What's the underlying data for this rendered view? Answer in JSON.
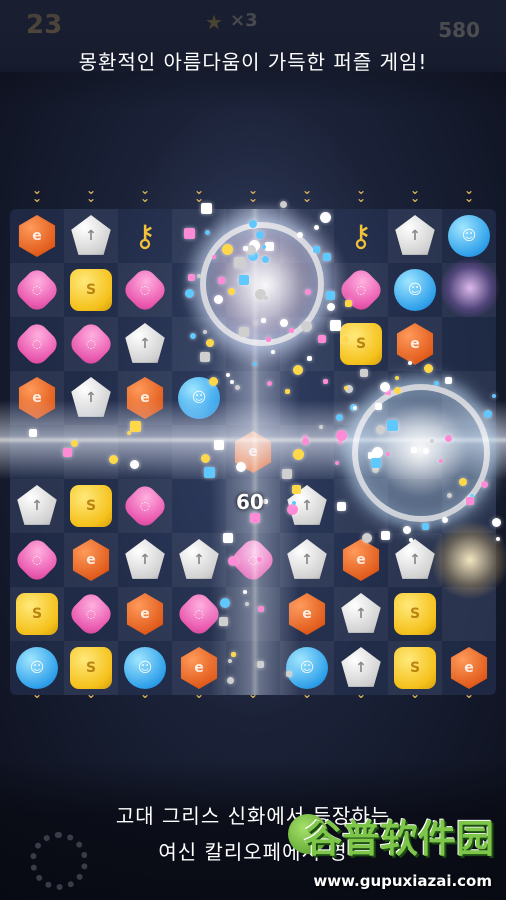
{
  "hud": {
    "score_left": "23",
    "combo": "×3",
    "score_right": "580"
  },
  "top_banner": {
    "text": "몽환적인 아름다움이 가득한 퍼즐 게임!"
  },
  "bottom_banner": {
    "line1": "고대 그리스 신화에서 등장하는",
    "line2": "여신 칼리오페에서 영"
  },
  "effect": {
    "points": "60"
  },
  "watermark": {
    "title": "谷普软件园",
    "url": "www.gupuxiazai.com"
  },
  "colors": {
    "orange": "#e05a1a",
    "pink": "#ea5ab0",
    "yellow": "#f5c11c",
    "white": "#cfcfcf",
    "blue": "#2fa0ea",
    "key": "#f2c23a"
  },
  "board": {
    "columns": 9,
    "rows": 9,
    "grid": [
      [
        "orange",
        "white",
        "key",
        "",
        "",
        "",
        "key",
        "white",
        "blue"
      ],
      [
        "pink",
        "yellow",
        "pink",
        "",
        "",
        "",
        "pink",
        "blue",
        ""
      ],
      [
        "pink",
        "pink",
        "white",
        "",
        "",
        "",
        "yellow",
        "orange",
        ""
      ],
      [
        "orange",
        "white",
        "orange",
        "blue",
        "",
        "",
        "",
        "",
        ""
      ],
      [
        "",
        "",
        "",
        "",
        "orange",
        "",
        "",
        "",
        ""
      ],
      [
        "white",
        "yellow",
        "pink",
        "",
        "",
        "white",
        "",
        "",
        ""
      ],
      [
        "pink",
        "orange",
        "white",
        "white",
        "pink",
        "white",
        "orange",
        "white",
        ""
      ],
      [
        "yellow",
        "pink",
        "orange",
        "pink",
        "",
        "orange",
        "white",
        "yellow",
        ""
      ],
      [
        "blue",
        "yellow",
        "blue",
        "orange",
        "",
        "blue",
        "white",
        "yellow",
        "orange"
      ]
    ]
  }
}
